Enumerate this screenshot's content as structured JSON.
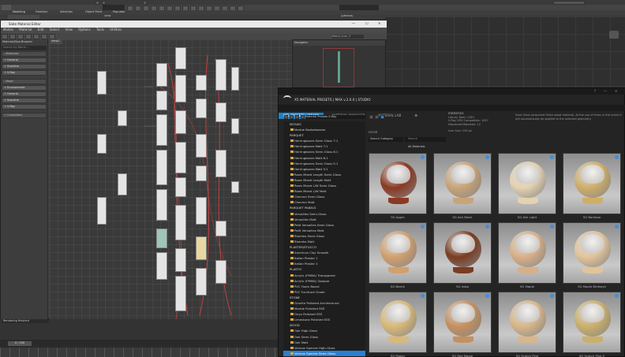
{
  "top": {
    "menus": [
      "Modeling",
      "Freeform",
      "Selection",
      "Object Paint",
      "Populate"
    ],
    "polygon_label": "Polygon Modeling",
    "view_dropdown": "View",
    "default_dropdown": "(Default)"
  },
  "slate": {
    "title": "Slate Material Editor",
    "menus": [
      "Modes",
      "Material",
      "Edit",
      "Select",
      "View",
      "Options",
      "Tools",
      "Utilities"
    ],
    "view_tab": "View1",
    "browser_title": "Material/Map Browser",
    "search_placeholder": "Search by Name ...",
    "groups": [
      {
        "label": "- Materials",
        "header": true
      },
      {
        "label": "+ General",
        "header": false
      },
      {
        "label": "+ Scanline",
        "header": false
      },
      {
        "label": "+ V-Ray",
        "header": false
      },
      {
        "label": "- Maps",
        "header": true
      },
      {
        "label": "+ Environment",
        "header": false
      },
      {
        "label": "+ General",
        "header": false
      },
      {
        "label": "+ Scanline",
        "header": false
      },
      {
        "label": "+ V-Ray",
        "header": false
      },
      {
        "label": "+ Controllers",
        "header": true
      }
    ],
    "navigator_title": "Navigator",
    "mpe_title": "Material Parameter Editor",
    "rendering_label": "Rendering finished",
    "view_dropdown_label": "Metal_Sum_3",
    "frame_counter": "0 / 100"
  },
  "x5": {
    "title": "X5 MATERIAL PRESETS | MAX v.2.0.0 | STUDIO",
    "tabs": [
      {
        "label": "MTL PRESETS LIBRARY",
        "active": true
      },
      {
        "label": "MATERIAL MANAGER",
        "active": false
      },
      {
        "label": "MATERIAL LAB",
        "active": false
      }
    ],
    "library_dropdown": "Material Presets V-Ray",
    "search_placeholder": "Search",
    "filter_label": "FILTER",
    "search_category": "Search Category",
    "all_materials": "All Materials",
    "statistics": {
      "heading": "STATISTICS",
      "lines": [
        "Library Total: 1183",
        "V-Ray GPU Compatible: 1057",
        "Displaced Materials: 12"
      ]
    },
    "info_text": "Dark Gloss lacquered finish wood material. At the use of trees in the scene it will automatically be applied to the selected geometry.",
    "size_text": "Icon Size: 128 px",
    "tree": [
      {
        "label": "MOSAIC",
        "type": "cat",
        "selected": false
      },
      {
        "label": "Marble Basketweave",
        "type": "item",
        "selected": false
      },
      {
        "label": "PARQUET",
        "type": "cat",
        "selected": false
      },
      {
        "label": "Herringbones Semi-Gloss 7:1",
        "type": "item",
        "selected": false
      },
      {
        "label": "Herringbones Matt 7:1",
        "type": "item",
        "selected": false
      },
      {
        "label": "Herringbones Semi-Gloss 8:1",
        "type": "item",
        "selected": false
      },
      {
        "label": "Herringbones Matt 8:1",
        "type": "item",
        "selected": false
      },
      {
        "label": "Herringbones Semi-Gloss 5:1",
        "type": "item",
        "selected": false
      },
      {
        "label": "Herringbones Matt 5:1",
        "type": "item",
        "selected": false
      },
      {
        "label": "Rows Mixed Length Semi-Gloss",
        "type": "item",
        "selected": false
      },
      {
        "label": "Rows Mixed Length Matt",
        "type": "item",
        "selected": false
      },
      {
        "label": "Rows Mixed L/W Semi-Gloss",
        "type": "item",
        "selected": false
      },
      {
        "label": "Rows Mixed L/W Matt",
        "type": "item",
        "selected": false
      },
      {
        "label": "Chevron Semi-Gloss",
        "type": "item",
        "selected": false
      },
      {
        "label": "Chevron Matt",
        "type": "item",
        "selected": false
      },
      {
        "label": "PARQUET PANELS",
        "type": "cat",
        "selected": false
      },
      {
        "label": "Versailles Semi-Gloss",
        "type": "item",
        "selected": false
      },
      {
        "label": "Versailles Matt",
        "type": "item",
        "selected": false
      },
      {
        "label": "Petit Versailles Semi-Gloss",
        "type": "item",
        "selected": false
      },
      {
        "label": "Petit Versailles Matt",
        "type": "item",
        "selected": false
      },
      {
        "label": "Rhombs Semi-Gloss",
        "type": "item",
        "selected": false
      },
      {
        "label": "Rhombs Matt",
        "type": "item",
        "selected": false
      },
      {
        "label": "PLASTER/STUCCO",
        "type": "cat",
        "selected": false
      },
      {
        "label": "American Clay Smooth",
        "type": "item",
        "selected": false
      },
      {
        "label": "Italian Plaster 1",
        "type": "item",
        "selected": false
      },
      {
        "label": "Italian Plaster 2",
        "type": "item",
        "selected": false
      },
      {
        "label": "PLASTIC",
        "type": "cat",
        "selected": false
      },
      {
        "label": "Acrylic (PMMA) Transparent",
        "type": "item",
        "selected": false
      },
      {
        "label": "Acrylic (PMMA) Opaque",
        "type": "item",
        "selected": false
      },
      {
        "label": "PVC Foam Board",
        "type": "item",
        "selected": false
      },
      {
        "label": "PVC Furniture Grade",
        "type": "item",
        "selected": false
      },
      {
        "label": "STONE",
        "type": "cat",
        "selected": false
      },
      {
        "label": "Granite Polished Architectural",
        "type": "item",
        "selected": false
      },
      {
        "label": "Marble Polished SSS",
        "type": "item",
        "selected": false
      },
      {
        "label": "Onyx Polished SSS",
        "type": "item",
        "selected": false
      },
      {
        "label": "Limestone Polished SSS",
        "type": "item",
        "selected": false
      },
      {
        "label": "WOOD",
        "type": "cat",
        "selected": false
      },
      {
        "label": "Oak High-Gloss",
        "type": "item",
        "selected": false
      },
      {
        "label": "Oak Semi-Gloss",
        "type": "item",
        "selected": false
      },
      {
        "label": "Oak Matt",
        "type": "item",
        "selected": false
      },
      {
        "label": "Various Species High-Gloss",
        "type": "item",
        "selected": false
      },
      {
        "label": "Various Species Semi-Gloss",
        "type": "item",
        "selected": true
      }
    ],
    "materials": [
      {
        "label": "SG Apple",
        "color": "#8a3a22"
      },
      {
        "label": "SG Ash Black",
        "color": "#c8a478"
      },
      {
        "label": "SG Ash Light",
        "color": "#e4d2b0"
      },
      {
        "label": "SG Bamboo",
        "color": "#cfae6a"
      },
      {
        "label": "SG Beech",
        "color": "#d2a06e"
      },
      {
        "label": "SG Iroko",
        "color": "#7a3c22"
      },
      {
        "label": "SG Maple",
        "color": "#d8b088"
      },
      {
        "label": "SG Maple Birdseye",
        "color": "#e2c49a"
      },
      {
        "label": "SG Poplar",
        "color": "#d9b979"
      },
      {
        "label": "SG Red Maple",
        "color": "#c59060"
      },
      {
        "label": "SG Scotch Pine",
        "color": "#d8b78b"
      },
      {
        "label": "SG Scotch Pine 2",
        "color": "#cbb06c"
      }
    ]
  }
}
